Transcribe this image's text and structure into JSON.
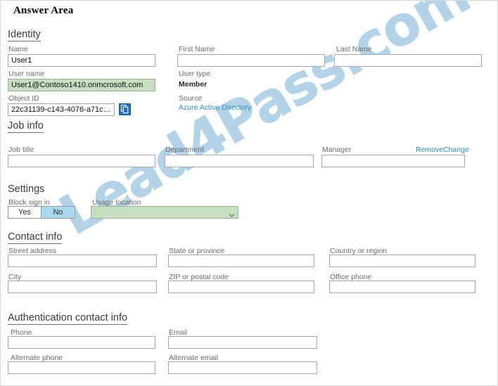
{
  "page": {
    "title": "Answer Area"
  },
  "watermark": {
    "text": "Lead4Pass.com",
    "color": "#9ec9e2"
  },
  "sections": {
    "identity": {
      "heading": "Identity",
      "fields": {
        "name": {
          "label": "Name",
          "value": "User1",
          "placeholder": ""
        },
        "first_name": {
          "label": "First Name",
          "value": "",
          "placeholder": ""
        },
        "last_name": {
          "label": "Last Name",
          "value": "",
          "placeholder": ""
        },
        "user_name": {
          "label": "User name",
          "value": "User1@Contoso1410.onmcrosoft.com",
          "placeholder": ""
        },
        "user_type": {
          "label": "User type",
          "value": "Member"
        },
        "object_id": {
          "label": "Object ID",
          "value": "22c31139-c143-4076-a71c-b5d0d5...",
          "placeholder": ""
        },
        "source": {
          "label": "Source",
          "value": "Azure Active Directory"
        }
      },
      "copy_button": {
        "name": "copy-icon",
        "title": "Copy"
      }
    },
    "job_info": {
      "heading": "Job info",
      "fields": {
        "job_title": {
          "label": "Job title",
          "value": "",
          "placeholder": ""
        },
        "department": {
          "label": "Department",
          "value": "",
          "placeholder": ""
        },
        "manager": {
          "label": "Manager",
          "value": "",
          "placeholder": ""
        }
      },
      "actions": {
        "remove": "Remove",
        "change": "Change"
      }
    },
    "settings": {
      "heading": "Settings",
      "block_sign_in": {
        "label": "Block sign in",
        "options": [
          "Yes",
          "No"
        ],
        "selected": "No"
      },
      "usage_location": {
        "label": "Usage location",
        "value": "",
        "placeholder": ""
      }
    },
    "contact_info": {
      "heading": "Contact info",
      "fields": {
        "street_address": {
          "label": "Street address",
          "value": "",
          "placeholder": ""
        },
        "state_or_province": {
          "label": "State or province",
          "value": "",
          "placeholder": ""
        },
        "country_or_region": {
          "label": "Country or region",
          "value": "",
          "placeholder": ""
        },
        "city": {
          "label": "City",
          "value": "",
          "placeholder": ""
        },
        "zip_or_postal_code": {
          "label": "ZIP or postal code",
          "value": "",
          "placeholder": ""
        },
        "office_phone": {
          "label": "Office phone",
          "value": "",
          "placeholder": ""
        }
      }
    },
    "authentication_contact_info": {
      "heading": "Authentication contact info",
      "fields": {
        "phone": {
          "label": "Phone",
          "value": "",
          "placeholder": ""
        },
        "email": {
          "label": "Email",
          "value": "",
          "placeholder": ""
        },
        "alternate_phone": {
          "label": "Alternate phone",
          "value": "",
          "placeholder": ""
        },
        "alternate_email": {
          "label": "Alternate email",
          "value": "",
          "placeholder": ""
        }
      }
    }
  },
  "colors": {
    "highlight_green": "#c6dfc1",
    "toggle_selected_blue": "#a9d9ef",
    "link_blue": "#2a8fc4",
    "copy_button_blue": "#1f6fb4"
  }
}
